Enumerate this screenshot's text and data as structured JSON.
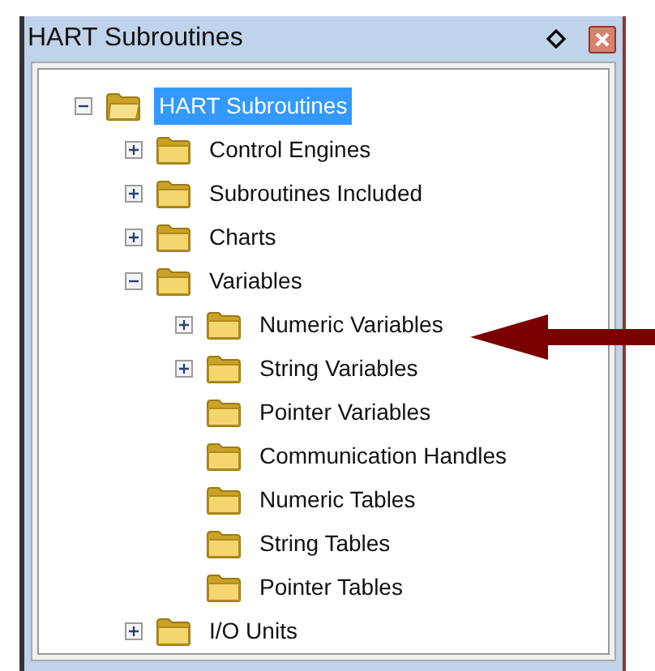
{
  "window": {
    "title": "HART Subroutines"
  },
  "tree": [
    {
      "label": "HART Subroutines",
      "kind": "expanded",
      "selected": true,
      "children": [
        {
          "label": "Control Engines",
          "kind": "collapsed",
          "selected": false
        },
        {
          "label": "Subroutines Included",
          "kind": "collapsed",
          "selected": false
        },
        {
          "label": "Charts",
          "kind": "collapsed",
          "selected": false
        },
        {
          "label": "Variables",
          "kind": "expanded",
          "selected": false,
          "children": [
            {
              "label": "Numeric Variables",
              "kind": "collapsed",
              "selected": false
            },
            {
              "label": "String Variables",
              "kind": "collapsed",
              "selected": false
            },
            {
              "label": "Pointer Variables",
              "kind": "leaf",
              "selected": false
            },
            {
              "label": "Communication Handles",
              "kind": "leaf",
              "selected": false
            },
            {
              "label": "Numeric Tables",
              "kind": "leaf",
              "selected": false
            },
            {
              "label": "String Tables",
              "kind": "leaf",
              "selected": false
            },
            {
              "label": "Pointer Tables",
              "kind": "leaf",
              "selected": false
            }
          ]
        },
        {
          "label": "I/O Units",
          "kind": "collapsed",
          "selected": false
        }
      ]
    }
  ]
}
